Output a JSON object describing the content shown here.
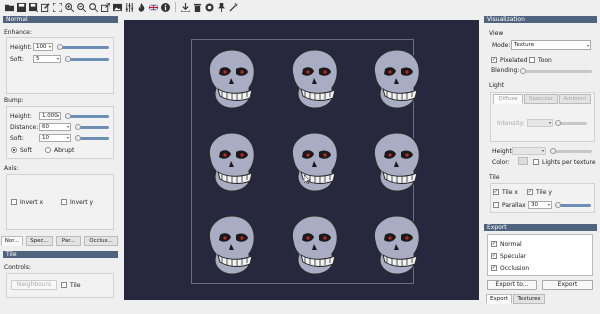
{
  "toolbar": {
    "icons": [
      "folder-open-icon",
      "save-icon",
      "save-as-icon",
      "edit-icon",
      "fit-view-icon",
      "zoom-in-icon",
      "zoom-out-icon",
      "zoom-reset-icon",
      "external-open-icon",
      "image-icon",
      "sliders-icon",
      "fire-icon",
      "flag-uk-icon",
      "info-icon",
      "download-icon",
      "trash-icon",
      "record-icon",
      "pin-icon",
      "magic-wand-icon"
    ]
  },
  "left": {
    "normal_header": "Normal",
    "enhance_title": "Enhance:",
    "enhance_height_label": "Height:",
    "enhance_height_value": "100",
    "enhance_soft_label": "Soft:",
    "enhance_soft_value": "5",
    "bump_title": "Bump:",
    "bump_height_label": "Height:",
    "bump_height_value": "1.000",
    "bump_distance_label": "Distance:",
    "bump_distance_value": "60",
    "bump_soft_label": "Soft:",
    "bump_soft_value": "10",
    "radio_soft": "Soft",
    "radio_abrupt": "Abrupt",
    "axis_title": "Axis:",
    "invert_x": "Invert x",
    "invert_y": "Invert y",
    "tabs": [
      "Nor...",
      "Spec...",
      "Par...",
      "Occlus..."
    ],
    "tile_header": "Tile",
    "controls_title": "Controls:",
    "neighbours_button": "Neighbours",
    "tile_checkbox": "Tile"
  },
  "right": {
    "viz_header": "Visualization",
    "view_title": "View",
    "mode_label": "Mode:",
    "mode_value": "Texture",
    "pixelated": "Pixelated",
    "toon": "Toon",
    "blending_label": "Blending:",
    "light_title": "Light",
    "light_tabs": [
      "Diffuse",
      "Specular",
      "Ambient"
    ],
    "intensity_label": "Intensity:",
    "height_label": "Height:",
    "color_label": "Color:",
    "lights_per_texture": "Lights per texture",
    "tile_title": "Tile",
    "tile_x": "Tile x",
    "tile_y": "Tile y",
    "parallax": "Parallax",
    "parallax_value": "30",
    "export_header": "Export",
    "export_items": [
      "Normal",
      "Specular",
      "Occlusion"
    ],
    "export_to_button": "Export to...",
    "export_button": "Export",
    "bottom_tabs": [
      "Export",
      "Textures"
    ]
  },
  "colors": {
    "panel_header": "#51647f",
    "viewport_bg": "#27283e",
    "slider_fill": "#6e8fb5",
    "skull_fill": "#a8adc4",
    "skull_eye": "#cc2222"
  }
}
